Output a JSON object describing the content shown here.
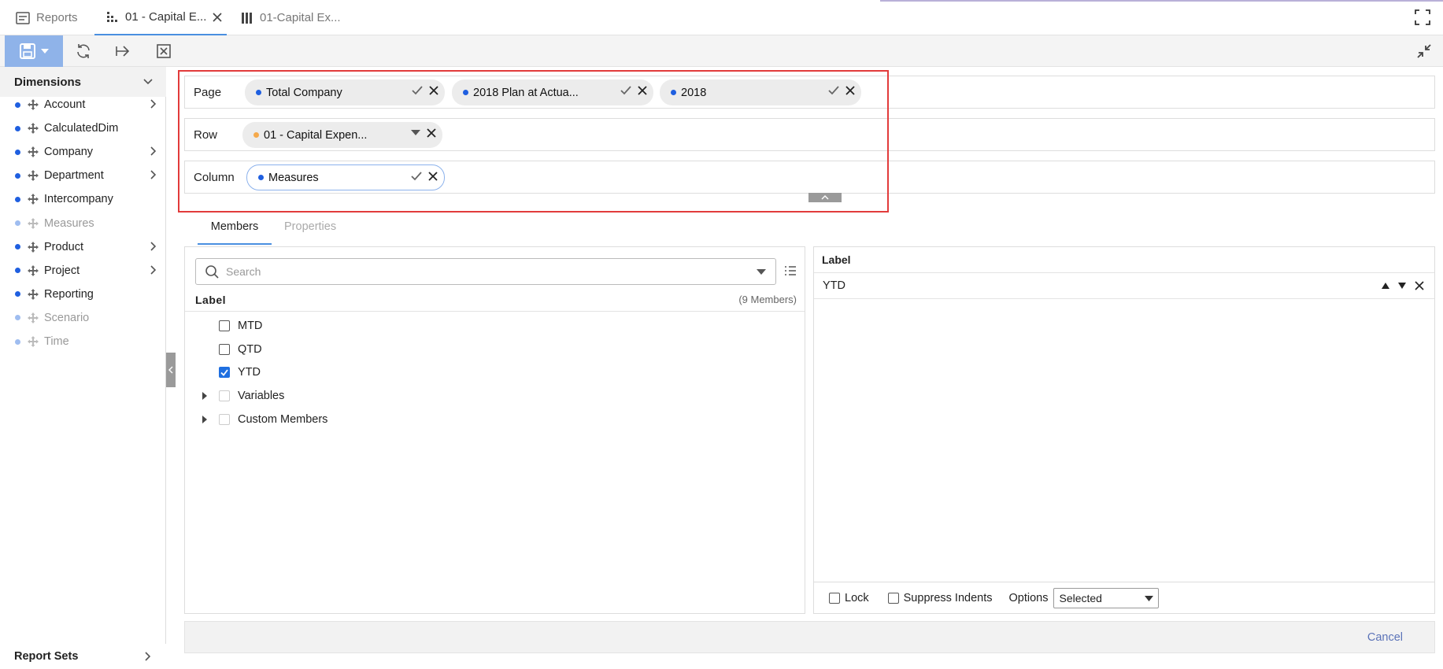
{
  "tabs": [
    {
      "label": "Reports",
      "icon": "report-icon"
    },
    {
      "label": "01 - Capital E...",
      "icon": "grid-icon",
      "active": true
    },
    {
      "label": "01-Capital Ex...",
      "icon": "columns-icon"
    }
  ],
  "sidebar": {
    "header": "Dimensions",
    "items": [
      {
        "label": "Account",
        "enabled": true,
        "expandable": true
      },
      {
        "label": "CalculatedDim",
        "enabled": true,
        "expandable": false
      },
      {
        "label": "Company",
        "enabled": true,
        "expandable": true
      },
      {
        "label": "Department",
        "enabled": true,
        "expandable": true
      },
      {
        "label": "Intercompany",
        "enabled": true,
        "expandable": false
      },
      {
        "label": "Measures",
        "enabled": false,
        "expandable": false
      },
      {
        "label": "Product",
        "enabled": true,
        "expandable": true
      },
      {
        "label": "Project",
        "enabled": true,
        "expandable": true
      },
      {
        "label": "Reporting",
        "enabled": true,
        "expandable": false
      },
      {
        "label": "Scenario",
        "enabled": false,
        "expandable": false
      },
      {
        "label": "Time",
        "enabled": false,
        "expandable": false
      }
    ],
    "footer": "Report Sets"
  },
  "layout": {
    "page": {
      "title": "Page",
      "chips": [
        "Total Company",
        "2018 Plan at Actua...",
        "2018"
      ]
    },
    "row": {
      "title": "Row",
      "chips": [
        "01 - Capital Expen..."
      ]
    },
    "column": {
      "title": "Column",
      "chips": [
        "Measures"
      ]
    }
  },
  "subtabs": {
    "members": "Members",
    "properties": "Properties"
  },
  "members": {
    "search_placeholder": "Search",
    "label_header": "Label",
    "count": "(9 Members)",
    "items": [
      {
        "label": "MTD",
        "checked": false,
        "expandable": false
      },
      {
        "label": "QTD",
        "checked": false,
        "expandable": false
      },
      {
        "label": "YTD",
        "checked": true,
        "expandable": false
      },
      {
        "label": "Variables",
        "checked": false,
        "expandable": true
      },
      {
        "label": "Custom Members",
        "checked": false,
        "expandable": true
      }
    ]
  },
  "selected": {
    "header": "Label",
    "items": [
      "YTD"
    ],
    "lock_label": "Lock",
    "suppress_label": "Suppress Indents",
    "options_label": "Options",
    "options_value": "Selected"
  },
  "footer": {
    "cancel": "Cancel"
  },
  "colors": {
    "accent": "#1f5fe0",
    "row_dot": "#f5a94b",
    "highlight": "#e23b3b"
  }
}
